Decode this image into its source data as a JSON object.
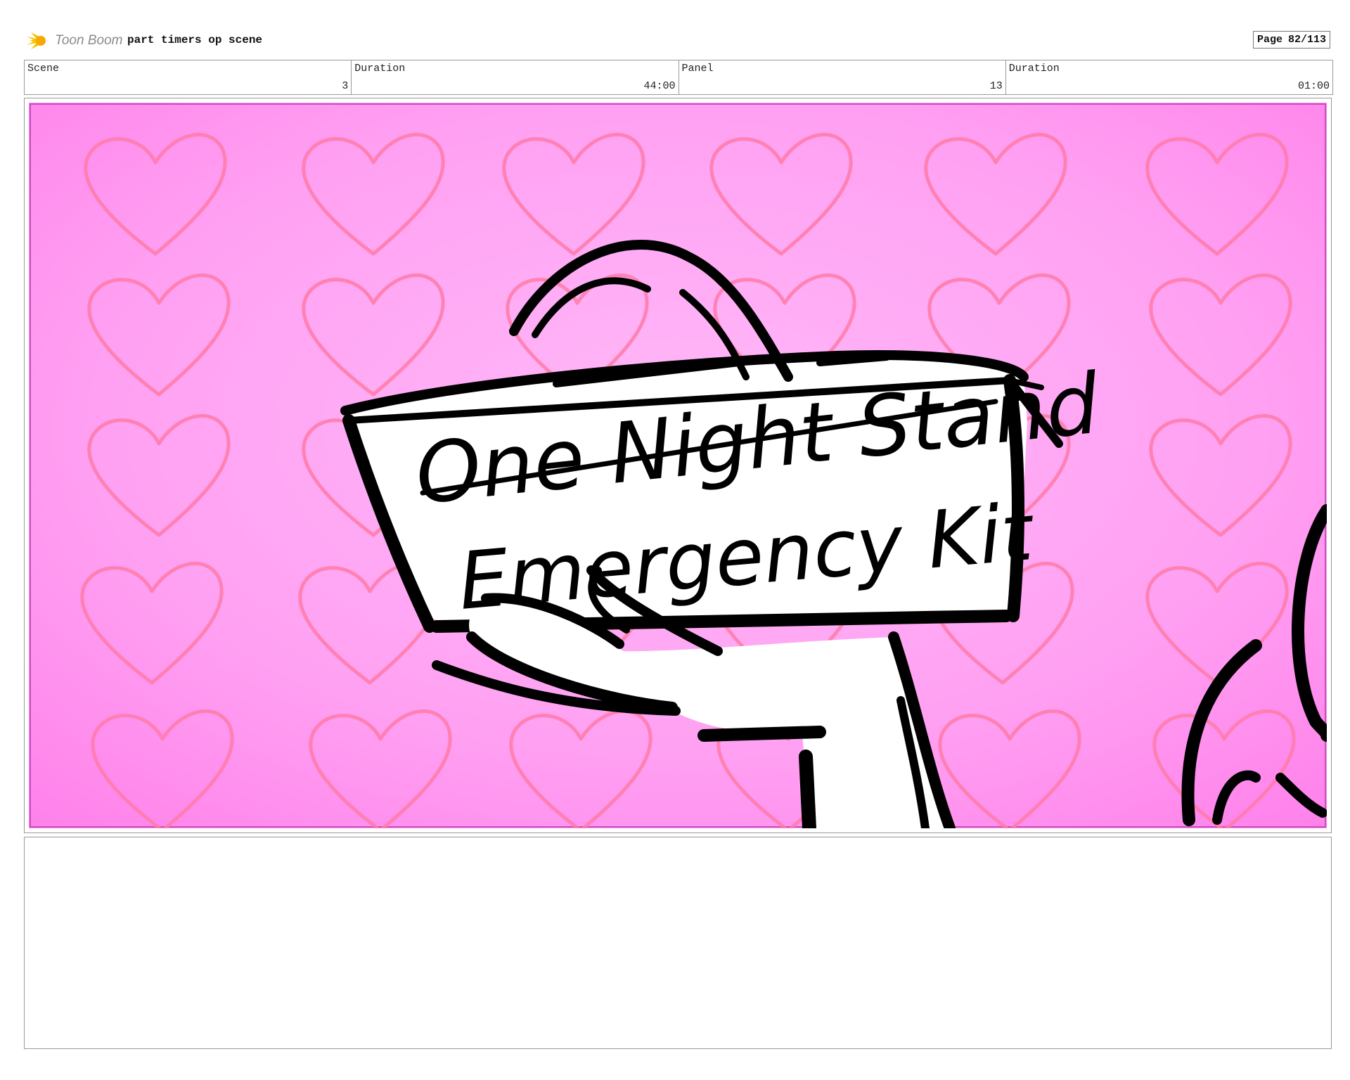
{
  "header": {
    "logo_text": "Toon Boom",
    "project_title": "part timers op scene",
    "page_label": "Page",
    "page_value": "82/113"
  },
  "info": {
    "scene_label": "Scene",
    "scene_value": "3",
    "scene_duration_label": "Duration",
    "scene_duration_value": "44:00",
    "panel_label": "Panel",
    "panel_value": "13",
    "panel_duration_label": "Duration",
    "panel_duration_value": "01:00"
  },
  "artwork": {
    "sign_line1": "One Night Stand",
    "sign_line2": "Emergency Kit",
    "background_color": "#ff9cf0",
    "heart_color": "#ff6f9a"
  },
  "notes": {
    "text": ""
  }
}
